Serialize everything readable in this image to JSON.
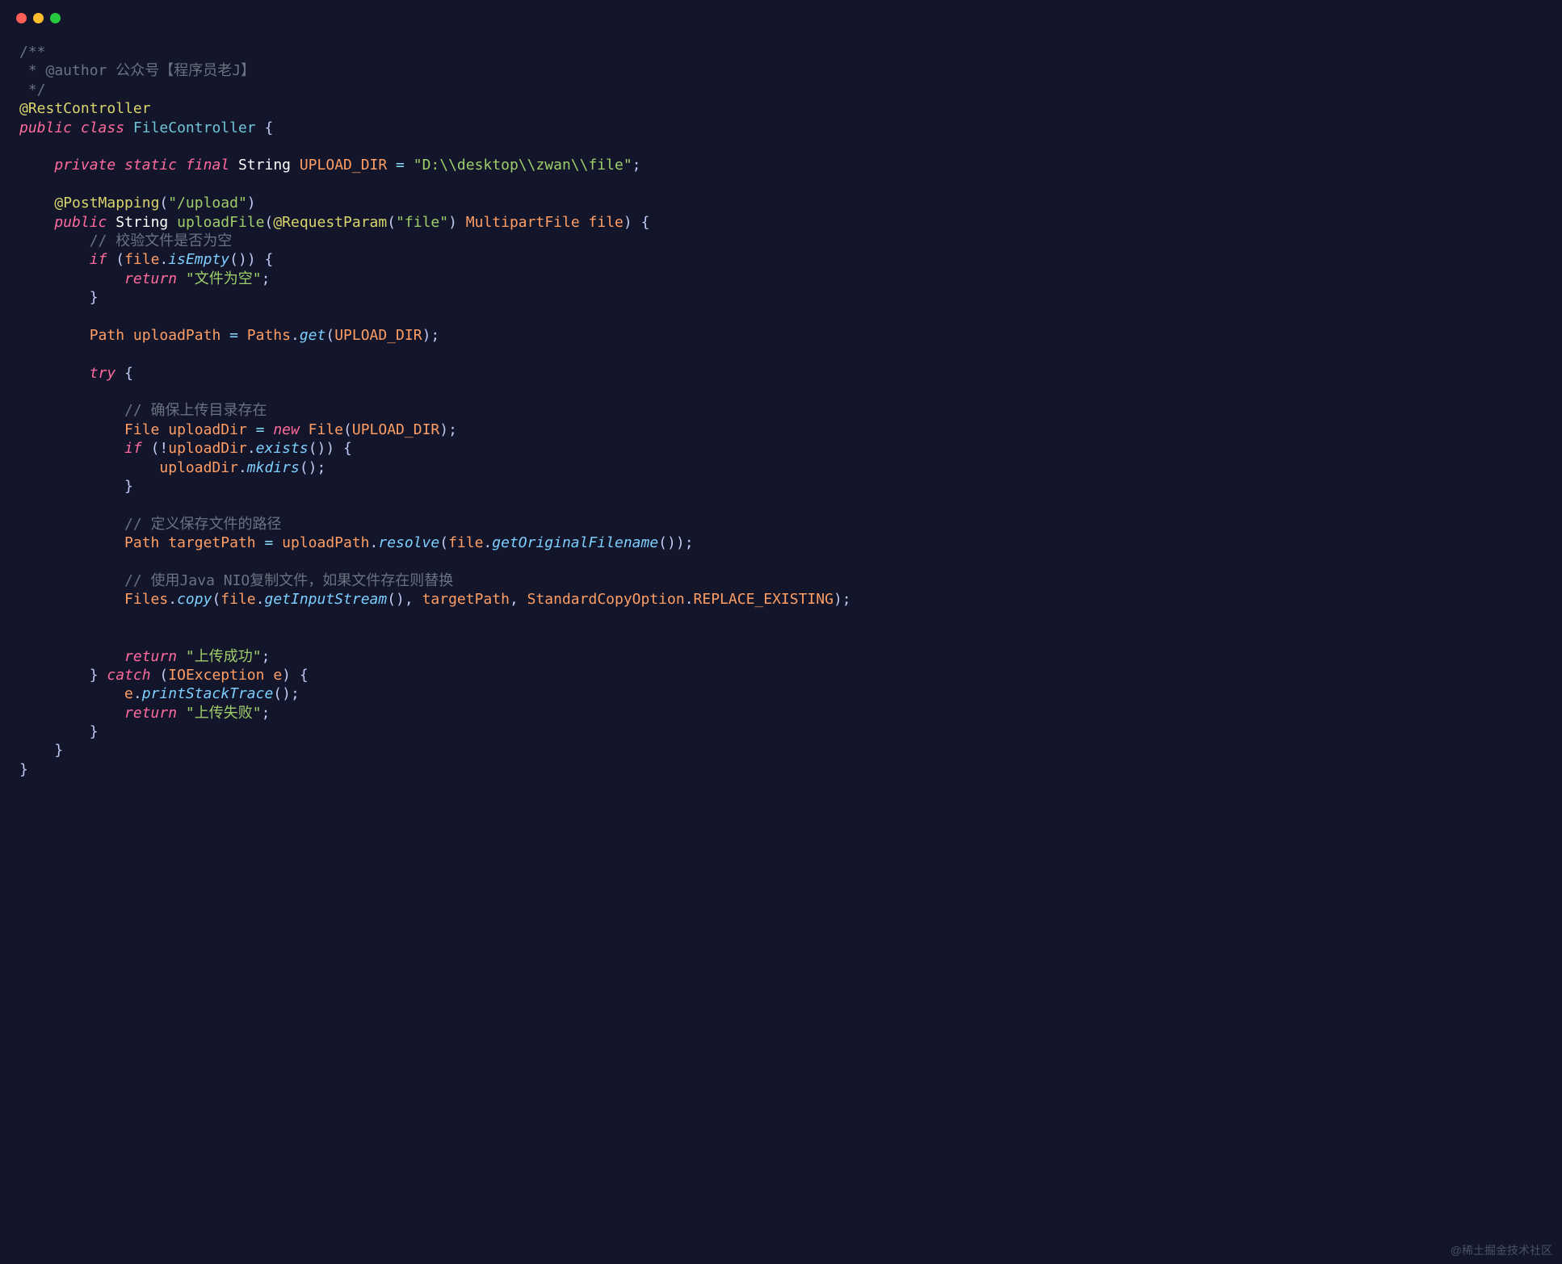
{
  "code": {
    "comment_open": "/**",
    "comment_author_prefix": " * @author ",
    "comment_author": "公众号【程序员老J】",
    "comment_close": " */",
    "annotation_rest": "@RestController",
    "kw_public": "public",
    "kw_class": "class",
    "class_name": "FileController",
    "brace_open": " {",
    "kw_private": "private",
    "kw_static": "static",
    "kw_final": "final",
    "type_string": "String",
    "const_upload_dir": "UPLOAD_DIR",
    "assign": " = ",
    "str_upload_dir": "\"D:\\\\desktop\\\\zwan\\\\file\"",
    "semi": ";",
    "annotation_post": "@PostMapping",
    "str_upload_path": "\"/upload\"",
    "method_upload": "uploadFile",
    "annotation_reqparam": "@RequestParam",
    "str_file": "\"file\"",
    "type_multipart": "MultipartFile",
    "param_file": "file",
    "comment_validate": "// 校验文件是否为空",
    "kw_if": "if",
    "method_isempty": "isEmpty",
    "kw_return": "return",
    "str_file_empty": "\"文件为空\"",
    "type_path": "Path",
    "var_uploadpath": "uploadPath",
    "class_paths": "Paths",
    "method_get": "get",
    "kw_try": "try",
    "comment_ensure_dir": "// 确保上传目录存在",
    "type_file": "File",
    "var_uploaddir": "uploadDir",
    "kw_new": "new",
    "class_file": "File",
    "method_exists": "exists",
    "method_mkdirs": "mkdirs",
    "comment_define_path": "// 定义保存文件的路径",
    "var_targetpath": "targetPath",
    "method_resolve": "resolve",
    "method_getoriginal": "getOriginalFilename",
    "comment_nio_copy": "// 使用Java NIO复制文件，如果文件存在则替换",
    "class_files": "Files",
    "method_copy": "copy",
    "method_getinputstream": "getInputStream",
    "class_stdcopy": "StandardCopyOption",
    "const_replace": "REPLACE_EXISTING",
    "str_success": "\"上传成功\"",
    "kw_catch": "catch",
    "type_ioexception": "IOException",
    "param_e": "e",
    "method_printstack": "printStackTrace",
    "str_failure": "\"上传失败\""
  },
  "watermark": "@稀土掘金技术社区"
}
